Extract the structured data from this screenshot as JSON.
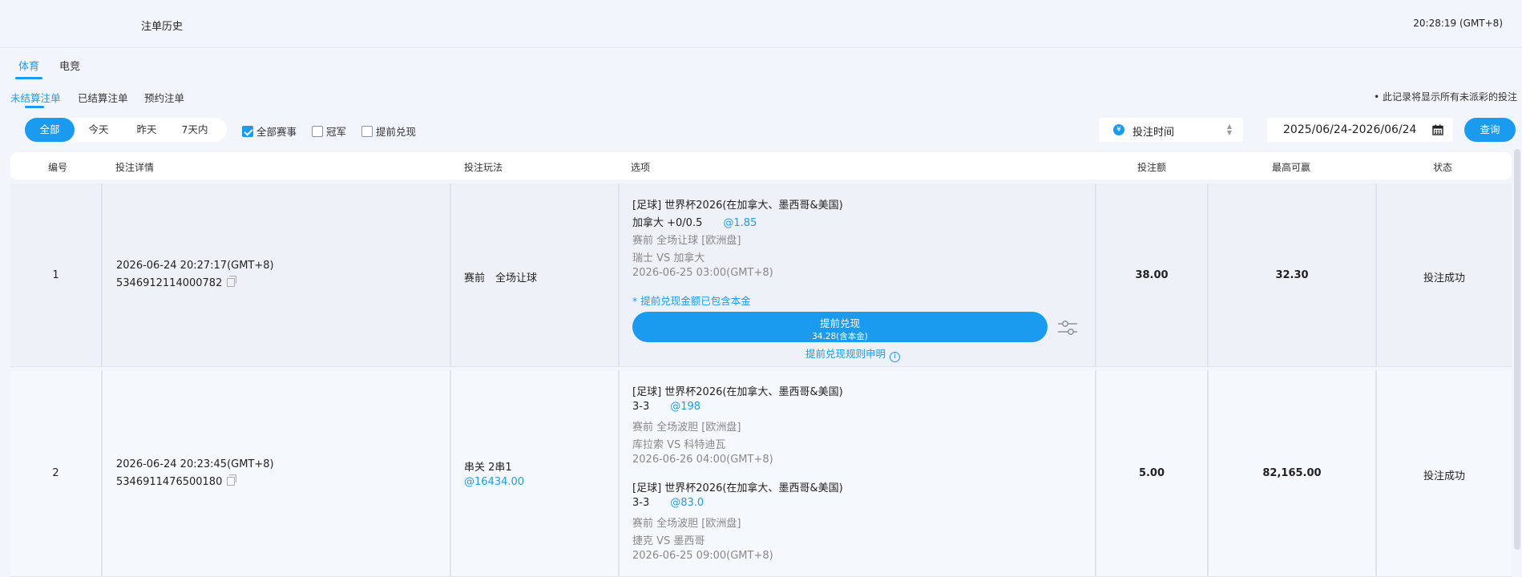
{
  "header": {
    "title": "注单历史",
    "clock": "20:28:19 (GMT+8)"
  },
  "sport_tabs": [
    {
      "label": "体育",
      "active": true
    },
    {
      "label": "电竞",
      "active": false
    }
  ],
  "status_tabs": [
    {
      "label": "未结算注单",
      "active": true
    },
    {
      "label": "已结算注单",
      "active": false
    },
    {
      "label": "预约注单",
      "active": false
    }
  ],
  "notice": "• 此记录将显示所有未派彩的投注",
  "filters": {
    "ranges": [
      {
        "label": "全部",
        "active": true
      },
      {
        "label": "今天",
        "active": false
      },
      {
        "label": "昨天",
        "active": false
      },
      {
        "label": "7天内",
        "active": false
      }
    ],
    "checkboxes": [
      {
        "label": "全部赛事",
        "checked": true
      },
      {
        "label": "冠军",
        "checked": false
      },
      {
        "label": "提前兑现",
        "checked": false
      }
    ],
    "sort_label": "投注时间",
    "date_range": "2025/06/24-2026/06/24",
    "search_label": "查询"
  },
  "columns": [
    "编号",
    "投注详情",
    "投注玩法",
    "选项",
    "投注额",
    "最高可赢",
    "状态"
  ],
  "rows": [
    {
      "no": "1",
      "time": "2026-06-24 20:27:17(GMT+8)",
      "ticket": "5346912114000782",
      "play": "赛前　全场让球",
      "play_odds": "",
      "selections": [
        {
          "league": "[足球] 世界杯2026(在加拿大、墨西哥&美国)",
          "pick": "加拿大 +0/0.5",
          "odds": "@1.85",
          "market": "赛前 全场让球 [欧洲盘]",
          "match": "瑞士 VS 加拿大",
          "kickoff": "2026-06-25 03:00(GMT+8)"
        }
      ],
      "cashout_note": "* 提前兑现金额已包含本金",
      "cashout_label": "提前兑现",
      "cashout_amount": "34.28(含本金)",
      "cashout_rules": "提前兑现规则申明",
      "stake": "38.00",
      "max_win": "32.30",
      "status": "投注成功"
    },
    {
      "no": "2",
      "time": "2026-06-24 20:23:45(GMT+8)",
      "ticket": "5346911476500180",
      "play": "串关 2串1",
      "play_odds": "@16434.00",
      "selections": [
        {
          "league": "[足球] 世界杯2026(在加拿大、墨西哥&美国)",
          "pick": "3-3",
          "odds": "@198",
          "market": "赛前 全场波胆 [欧洲盘]",
          "match": "库拉索 VS 科特迪瓦",
          "kickoff": "2026-06-26 04:00(GMT+8)"
        },
        {
          "league": "[足球] 世界杯2026(在加拿大、墨西哥&美国)",
          "pick": "3-3",
          "odds": "@83.0",
          "market": "赛前 全场波胆 [欧洲盘]",
          "match": "捷克 VS 墨西哥",
          "kickoff": "2026-06-25 09:00(GMT+8)"
        }
      ],
      "stake": "5.00",
      "max_win": "82,165.00",
      "status": "投注成功"
    }
  ],
  "colors": {
    "accent": "#1a9bf0",
    "background": "#f2f5fb"
  }
}
